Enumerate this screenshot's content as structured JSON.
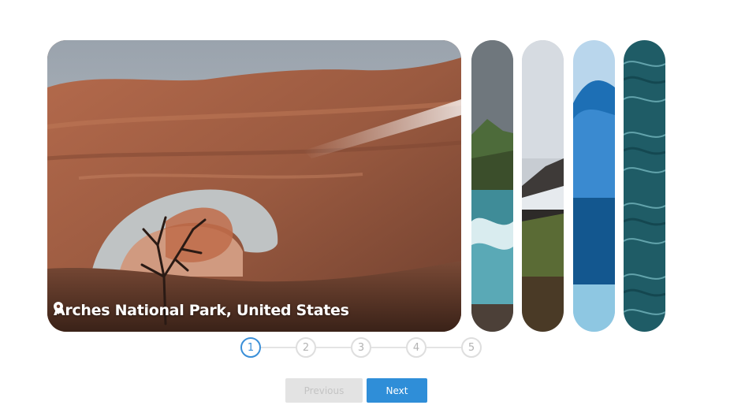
{
  "gallery": {
    "active_slide": {
      "caption": "Arches National Park, United States",
      "icon": "map-pin-icon"
    },
    "thumbnails": [
      {
        "scene": "coastal-cliffs-waterfall"
      },
      {
        "scene": "mountain-valley-mist"
      },
      {
        "scene": "iceberg-blue"
      },
      {
        "scene": "ocean-waves"
      }
    ]
  },
  "stepper": {
    "steps": [
      "1",
      "2",
      "3",
      "4",
      "5"
    ],
    "current": 1,
    "active_color": "#3a8fd8"
  },
  "controls": {
    "previous_label": "Previous",
    "next_label": "Next",
    "previous_enabled": false,
    "next_color": "#2f8ed8"
  }
}
